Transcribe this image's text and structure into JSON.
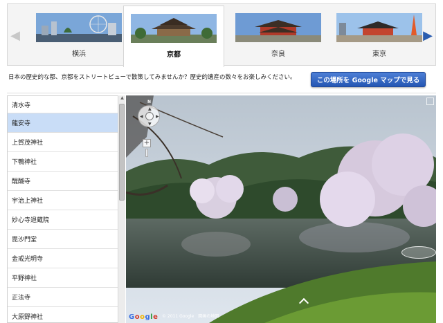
{
  "carousel": {
    "tabs": [
      {
        "label": "横浜"
      },
      {
        "label": "京都"
      },
      {
        "label": "奈良"
      },
      {
        "label": "東京"
      }
    ],
    "active_index": 1,
    "prev_icon": "chevron-left-icon",
    "next_icon": "chevron-right-icon"
  },
  "description": "日本の歴史的な都、京都をストリートビューで散策してみませんか？歴史的遺産の数々をお楽しみください。",
  "map_button_label": "この場所を Google マップで見る",
  "places": [
    "清水寺",
    "龍安寺",
    "上賀茂神社",
    "下鴨神社",
    "醍醐寺",
    "宇治上神社",
    "妙心寺退蔵院",
    "毘沙門堂",
    "金戒光明寺",
    "平野神社",
    "正法寺",
    "大原野神社"
  ],
  "selected_place_index": 1,
  "streetview": {
    "compass_label": "N",
    "zoom_in_label": "+",
    "copyright": "© 2011 Google",
    "terms": "図画の地図",
    "google_logo": [
      "G",
      "o",
      "o",
      "g",
      "l",
      "e"
    ]
  },
  "colors": {
    "accent": "#2456b3",
    "selected_row": "#c9ddf7",
    "logo": [
      "#3b6fe0",
      "#d43b2b",
      "#f2b400",
      "#3b6fe0",
      "#2e9b3d",
      "#d43b2b"
    ]
  }
}
